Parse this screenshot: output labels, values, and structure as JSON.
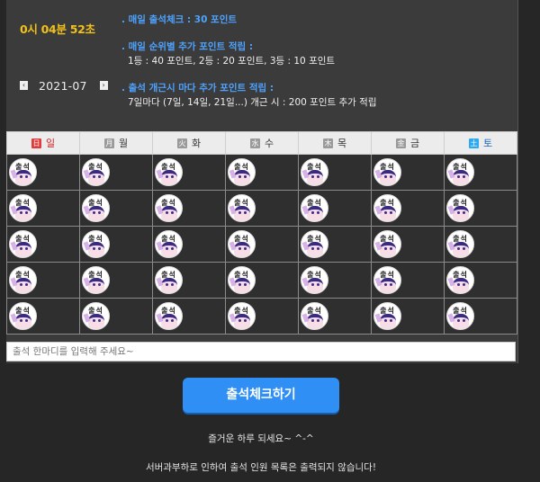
{
  "timer": "0시 04분 52초",
  "month": "2021-07",
  "nav": {
    "prev_icon": "chevron-left-icon",
    "next_icon": "chevron-right-icon",
    "prev": "‹",
    "next": "›"
  },
  "rules": {
    "daily_label": ". 매일 출석체크 : ",
    "daily_points": "30 포인트",
    "rank_label": ". 매일 순위별 추가 포인트 적립 :",
    "rank_detail": "1등 : 40 포인트,  2등 : 20 포인트,  3등 : 10 포인트",
    "streak_label": ". 출석 개근시 마다 추가 포인트 적립 :",
    "streak_detail": "7일마다 (7일, 14일, 21일...) 개근 시 : 200 포인트 추가 적립"
  },
  "weekdays": [
    {
      "box": "日",
      "label": "일",
      "box_color": "#e03a3a",
      "label_color": "#d02020"
    },
    {
      "box": "月",
      "label": "월",
      "box_color": "#9a9a9a",
      "label_color": "#333333"
    },
    {
      "box": "火",
      "label": "화",
      "box_color": "#9a9a9a",
      "label_color": "#333333"
    },
    {
      "box": "水",
      "label": "수",
      "box_color": "#9a9a9a",
      "label_color": "#333333"
    },
    {
      "box": "木",
      "label": "목",
      "box_color": "#9a9a9a",
      "label_color": "#333333"
    },
    {
      "box": "金",
      "label": "금",
      "box_color": "#9a9a9a",
      "label_color": "#333333"
    },
    {
      "box": "土",
      "label": "토",
      "box_color": "#2da8f2",
      "label_color": "#1565c0"
    }
  ],
  "stamp_text": "출석",
  "weeks": 5,
  "comment_placeholder": "출석 한마디를 입력해 주세요~",
  "submit_label": "출석체크하기",
  "message_1": "즐거운 하루 되세요~ ^-^",
  "message_2": "서버과부하로 인하여 출석 인원 목록은 출력되지 않습니다!"
}
